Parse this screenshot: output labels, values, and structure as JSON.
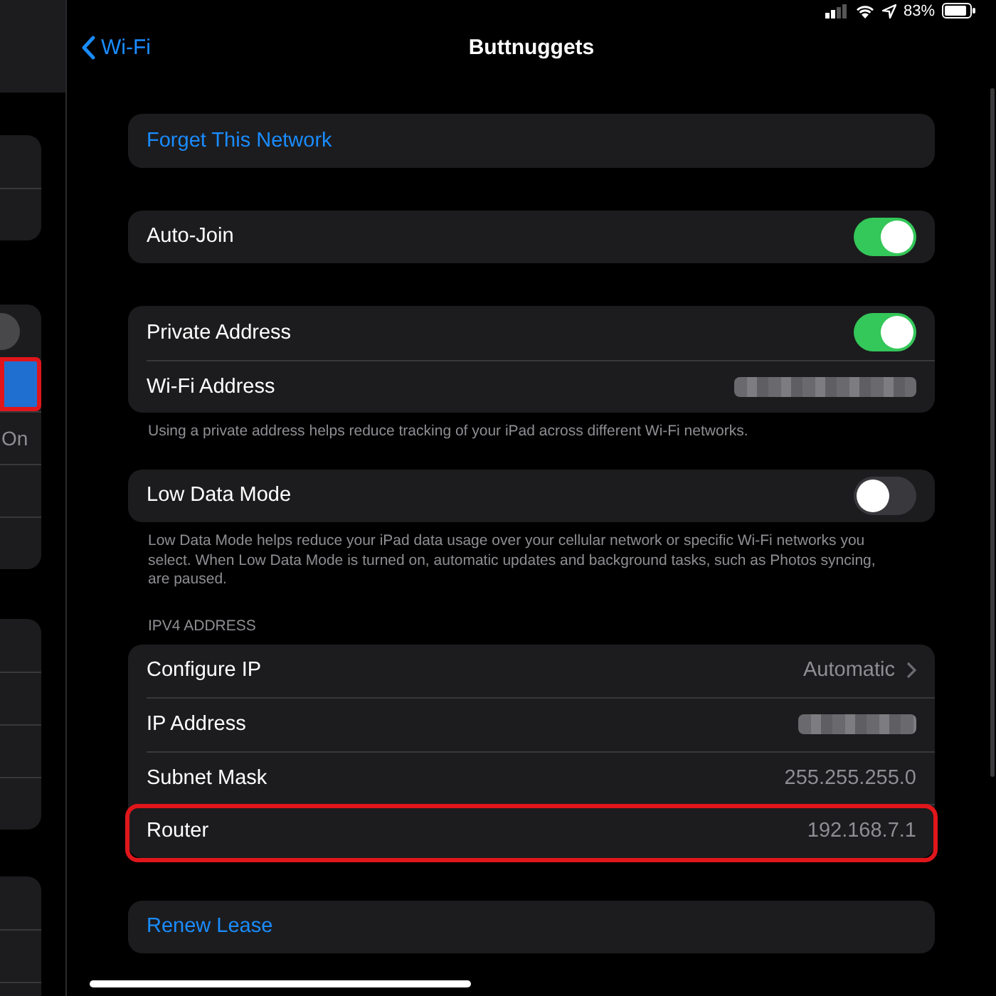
{
  "status_bar": {
    "battery": "83%"
  },
  "sidebar": {
    "cards": [
      {
        "rows": [
          {
            "kind": "blank"
          },
          {
            "kind": "blank"
          }
        ]
      },
      {
        "rows": [
          {
            "kind": "toggle",
            "on": false
          },
          {
            "kind": "selected",
            "selected": true,
            "annotated": true
          },
          {
            "kind": "value",
            "value": "On"
          },
          {
            "kind": "blank"
          },
          {
            "kind": "blank"
          }
        ]
      },
      {
        "rows": [
          {
            "kind": "blank"
          },
          {
            "kind": "blank"
          },
          {
            "kind": "blank"
          },
          {
            "kind": "blank"
          }
        ]
      },
      {
        "rows": [
          {
            "kind": "blank"
          },
          {
            "kind": "blank"
          },
          {
            "kind": "blank"
          }
        ]
      }
    ]
  },
  "nav": {
    "back": "Wi-Fi",
    "title": "Buttnuggets"
  },
  "groups": [
    {
      "rows": [
        {
          "kind": "action",
          "label": "Forget This Network"
        }
      ]
    },
    {
      "rows": [
        {
          "kind": "toggle",
          "label": "Auto-Join",
          "on": true
        }
      ]
    },
    {
      "rows": [
        {
          "kind": "toggle",
          "label": "Private Address",
          "on": true
        },
        {
          "kind": "redacted",
          "label": "Wi-Fi Address"
        }
      ],
      "footer": "Using a private address helps reduce tracking of your iPad across different Wi-Fi networks."
    },
    {
      "rows": [
        {
          "kind": "toggle",
          "label": "Low Data Mode",
          "on": false
        }
      ],
      "footer": "Low Data Mode helps reduce your iPad data usage over your cellular network or specific Wi-Fi networks you select. When Low Data Mode is turned on, automatic updates and background tasks, such as Photos syncing, are paused."
    },
    {
      "header": "IPV4 ADDRESS",
      "rows": [
        {
          "kind": "disclosure",
          "label": "Configure IP",
          "value": "Automatic"
        },
        {
          "kind": "redacted",
          "label": "IP Address"
        },
        {
          "kind": "value",
          "label": "Subnet Mask",
          "value": "255.255.255.0"
        },
        {
          "kind": "value",
          "label": "Router",
          "value": "192.168.7.1",
          "annotated": true
        }
      ]
    },
    {
      "rows": [
        {
          "kind": "action",
          "label": "Renew Lease"
        }
      ]
    }
  ]
}
